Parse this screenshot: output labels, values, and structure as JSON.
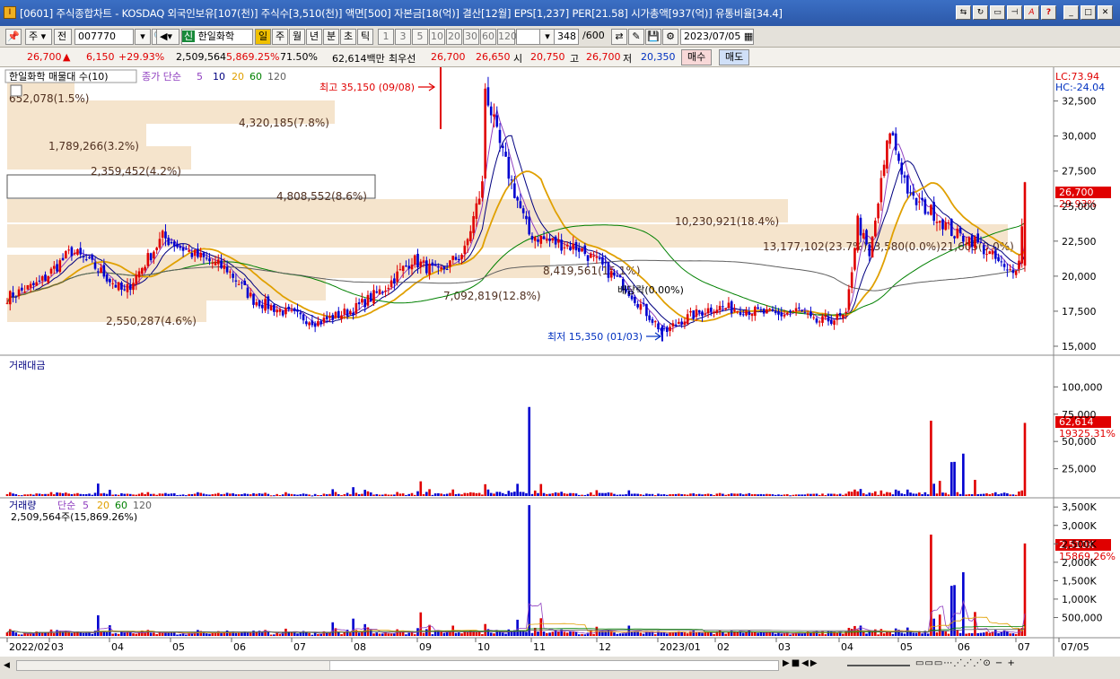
{
  "window": {
    "title": "[0601] 주식종합차트 - KOSDAQ 외국인보유[107(천)] 주식수[3,510(천)] 액면[500] 자본금[18(억)] 결산[12월] EPS[1,237] PER[21.58] 시가총액[937(억)] 유통비율[34.4]"
  },
  "toolbar": {
    "type": "주",
    "mode": "전",
    "code": "007770",
    "stock_badge": "신",
    "stock_name": "한일화학",
    "periods": [
      "일",
      "주",
      "월",
      "년",
      "분",
      "초",
      "틱"
    ],
    "intervals": [
      "1",
      "3",
      "5",
      "10",
      "20",
      "30",
      "60",
      "120"
    ],
    "count": "348",
    "total": "/600",
    "date": "2023/07/05"
  },
  "quote": {
    "price": "26,700",
    "change": "6,150",
    "pct": "+29.93%",
    "volume": "2,509,564",
    "vol_ratio": "5,869.25%",
    "rate": "71.50%",
    "amount": "62,614백만",
    "best_label": "최우선",
    "ask": "26,700",
    "bid": "26,650",
    "open_label": "시",
    "open": "20,750",
    "high_label": "고",
    "high": "26,700",
    "low_label": "저",
    "low": "20,350",
    "buy": "매수",
    "sell": "매도"
  },
  "panel_price": {
    "title": "한일화학 매물대 수(10)",
    "ma_label": "종가 단순",
    "ma_periods": [
      "5",
      "10",
      "20",
      "60",
      "120"
    ],
    "lc": "LC:73.94",
    "hc": "HC:-24.04",
    "price_tag": "26,700",
    "pct_tag": "29.93%",
    "high_label": "최고 35,150 (09/08)",
    "low_label": "최저 15,350 (01/03)",
    "dividend_label": "배당락(0.00%)",
    "axis": [
      "32,500",
      "30,000",
      "27,500",
      "25,000",
      "22,500",
      "20,000",
      "17,500",
      "15,000"
    ]
  },
  "volume_profile": [
    "652,078(1.5%)",
    "4,320,185(7.8%)",
    "1,789,266(3.2%)",
    "2,359,452(4.2%)",
    "4,808,552(8.6%)",
    "10,230,921(18.4%)",
    "13,177,102(23.7%)",
    "7,092,819(12.8%)",
    "8,419,561(15.1%)",
    "2,550,287(4.6%)",
    "23,580(0.0%)",
    "21,605(0.0%)"
  ],
  "panel_amount": {
    "title": "거래대금",
    "axis": [
      "100,000",
      "75,000",
      "50,000",
      "25,000"
    ],
    "tag": "62,614",
    "tag2": "19325.31%"
  },
  "panel_volume": {
    "title": "거래량",
    "ma_label": "단순",
    "ma_periods": [
      "5",
      "20",
      "60",
      "120"
    ],
    "current": "2,509,564주(15,869.26%)",
    "axis": [
      "3,500K",
      "3,000K",
      "2,500K",
      "2,000K",
      "1,500K",
      "1,000K",
      "500,000"
    ],
    "tag": "2,510K",
    "tag2": "15869.26%"
  },
  "date_axis": [
    "2022/02",
    "03",
    "04",
    "05",
    "06",
    "07",
    "08",
    "09",
    "10",
    "11",
    "12",
    "2023/01",
    "02",
    "03",
    "04",
    "05",
    "06",
    "07",
    "07/05"
  ],
  "chart_data": {
    "type": "candlestick",
    "title": "한일화학",
    "x_range": [
      "2022/02",
      "2023/07/05"
    ],
    "y_range": [
      15000,
      33500
    ],
    "high": {
      "value": 35150,
      "date": "09/08"
    },
    "low": {
      "value": 15350,
      "date": "01/03"
    },
    "last": {
      "value": 26700,
      "date": "2023/07/05"
    },
    "colors": {
      "up": "#e00000",
      "down": "#0000d0",
      "ma5": "#9040c0",
      "ma10": "#000080",
      "ma20": "#e0a000",
      "ma60": "#008000",
      "ma120": "#606060"
    }
  }
}
